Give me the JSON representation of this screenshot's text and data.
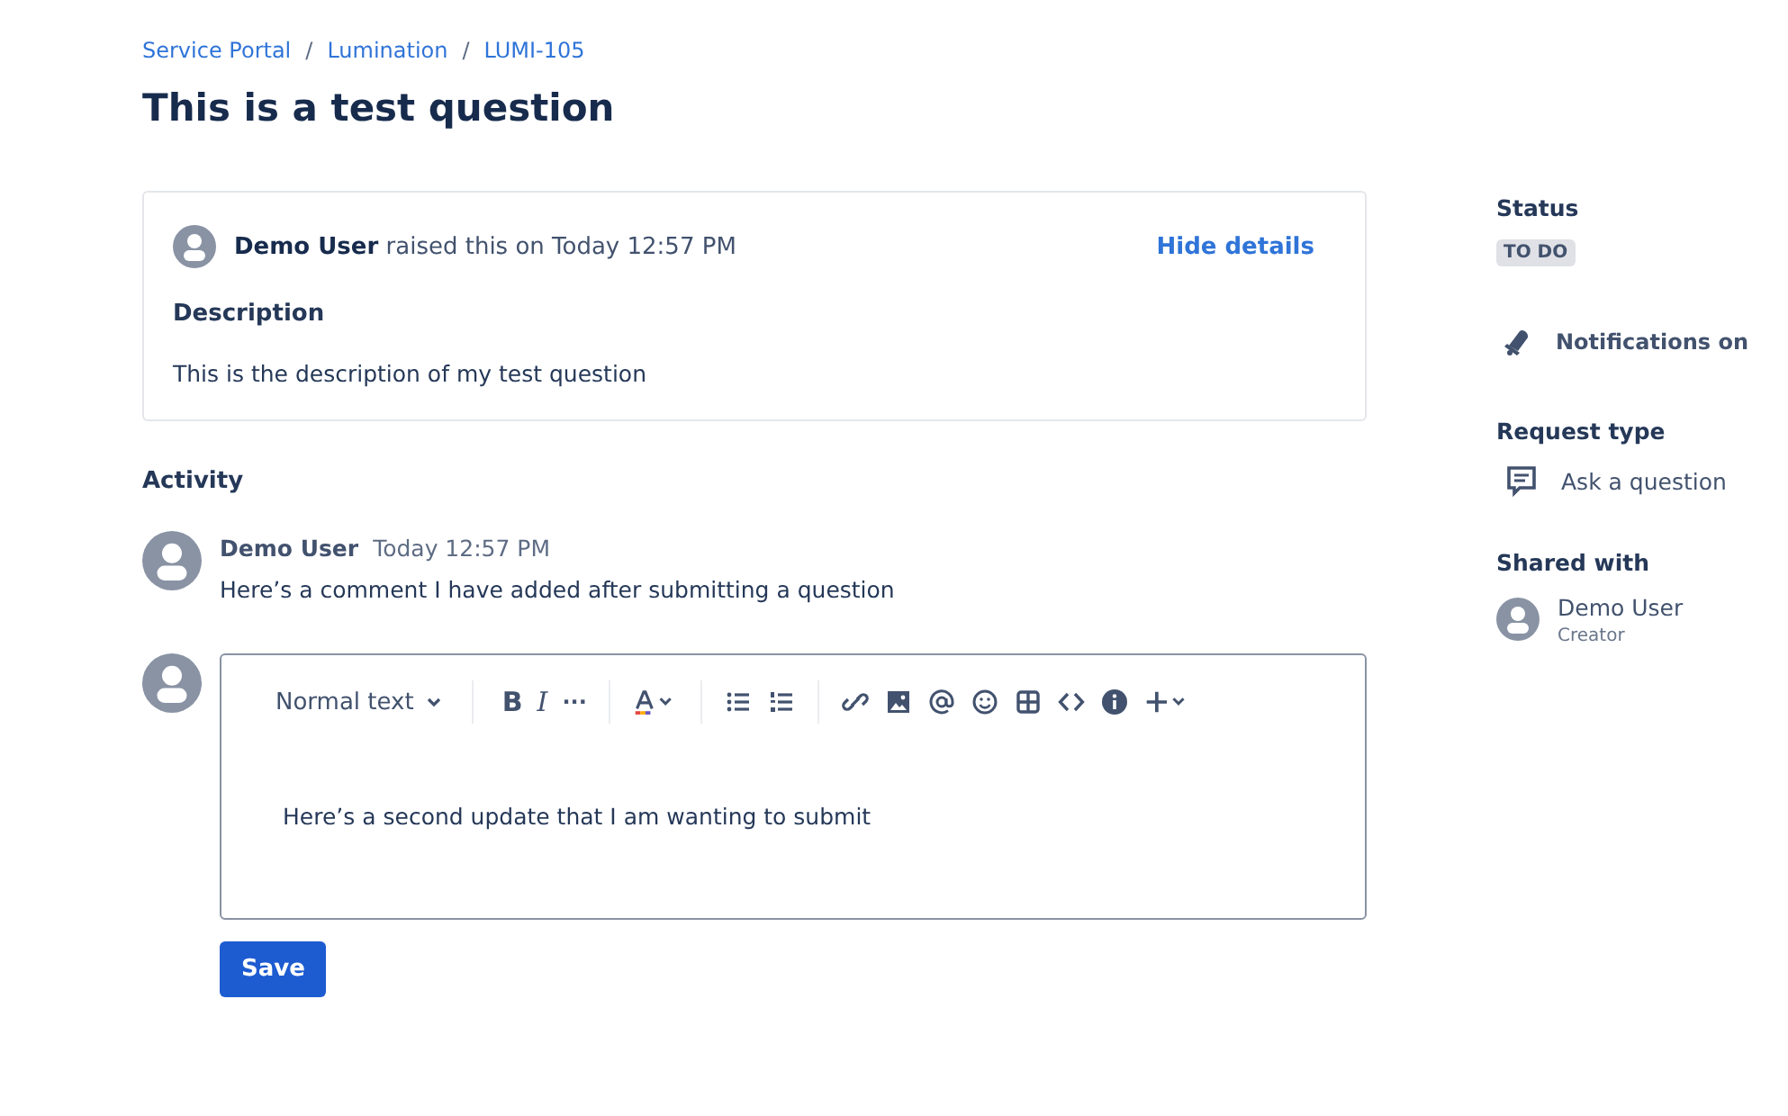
{
  "breadcrumbs": [
    {
      "label": "Service Portal"
    },
    {
      "separator": "/",
      "label": "Lumination"
    },
    {
      "separator": "/",
      "label": "LUMI-105"
    }
  ],
  "title": "This is a test question",
  "request": {
    "author": "Demo User",
    "raised": "raised this on Today 12:57 PM",
    "toggle": "Hide details",
    "description_label": "Description",
    "description": "This is the description of my test question"
  },
  "activity": {
    "heading": "Activity",
    "comments": [
      {
        "author": "Demo User",
        "time": "Today 12:57 PM",
        "text": "Here’s a comment I have added after submitting a question"
      }
    ]
  },
  "editor": {
    "style_menu": "Normal text",
    "bold": "B",
    "italic": "I",
    "more": "···",
    "value": "Here’s a second update that I am wanting to submit",
    "save": "Save"
  },
  "sidebar": {
    "status_label": "Status",
    "status": "TO DO",
    "notifications": "Notifications on",
    "request_type_label": "Request type",
    "request_type": "Ask a question",
    "shared_label": "Shared with",
    "shared": [
      {
        "name": "Demo User",
        "role": "Creator"
      }
    ]
  }
}
